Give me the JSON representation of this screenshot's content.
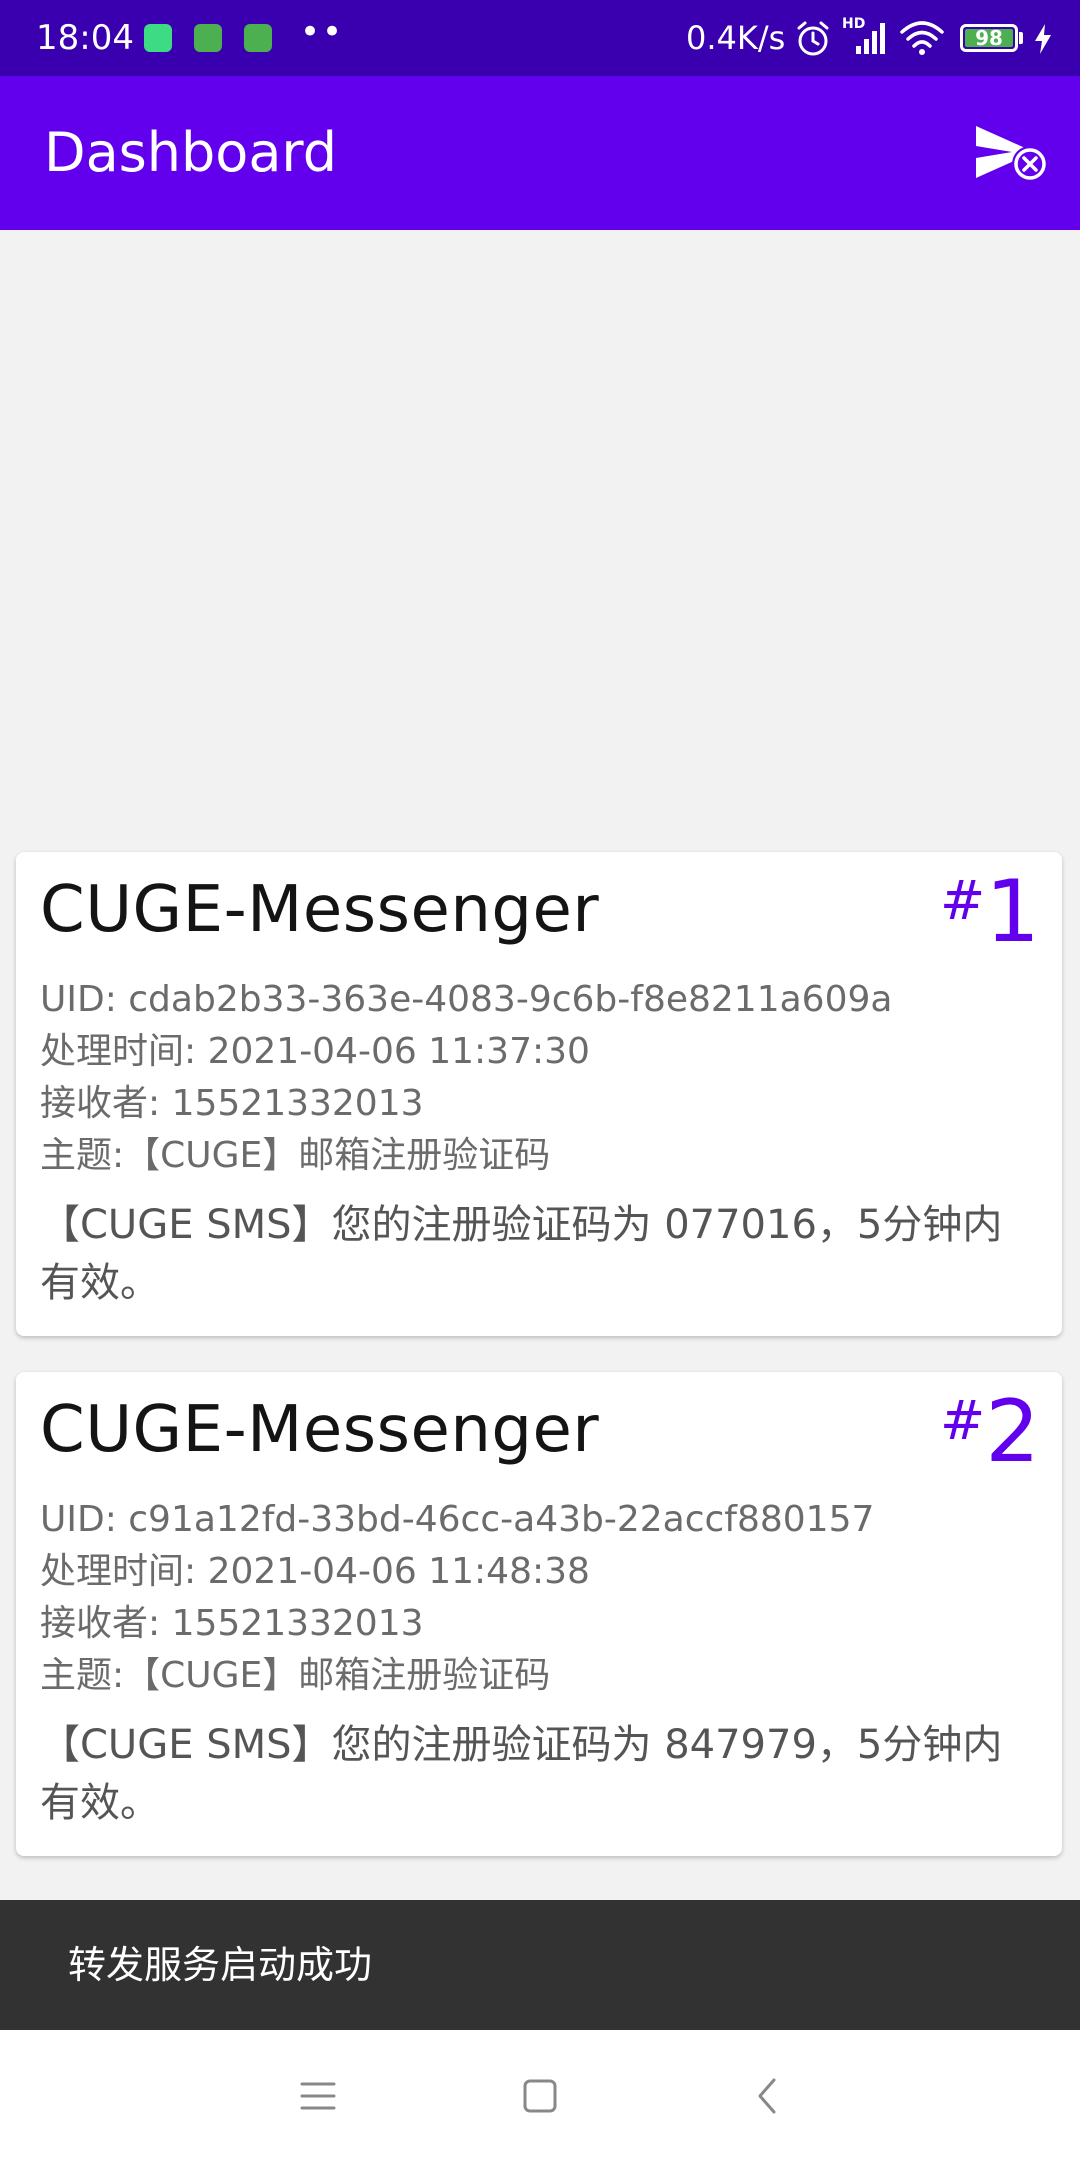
{
  "status_bar": {
    "time": "18:04",
    "network_speed": "0.4K/s",
    "network_type": "HD",
    "battery_level": "98",
    "battery_percent": 98,
    "notification_dots": "••",
    "icons": [
      "android-icon",
      "cat-icon",
      "cat-icon",
      "alarm-icon",
      "signal-icon",
      "wifi-icon",
      "battery-icon",
      "charging-icon"
    ]
  },
  "app_bar": {
    "title": "Dashboard",
    "action_icon": "send-cancel-icon"
  },
  "messages": [
    {
      "title": "CUGE-Messenger",
      "badge_hash": "#",
      "badge_number": "1",
      "uid": "UID: cdab2b33-363e-4083-9c6b-f8e8211a609a",
      "processed_time": "处理时间: 2021-04-06 11:37:30",
      "recipient": "接收者: 15521332013",
      "subject": "主题:【CUGE】邮箱注册验证码",
      "body": "【CUGE SMS】您的注册验证码为 077016，5分钟内有效。"
    },
    {
      "title": "CUGE-Messenger",
      "badge_hash": "#",
      "badge_number": "2",
      "uid": "UID: c91a12fd-33bd-46cc-a43b-22accf880157",
      "processed_time": "处理时间: 2021-04-06 11:48:38",
      "recipient": "接收者: 15521332013",
      "subject": "主题:【CUGE】邮箱注册验证码",
      "body": "【CUGE SMS】您的注册验证码为 847979，5分钟内有效。"
    }
  ],
  "toast": {
    "text": "转发服务启动成功"
  },
  "nav_bar": {
    "icons": [
      "menu-icon",
      "home-icon",
      "back-icon"
    ]
  },
  "colors": {
    "status_bar": "#3a00b0",
    "app_bar": "#6200ee",
    "accent": "#6200ee",
    "toast_bg": "#323232"
  }
}
